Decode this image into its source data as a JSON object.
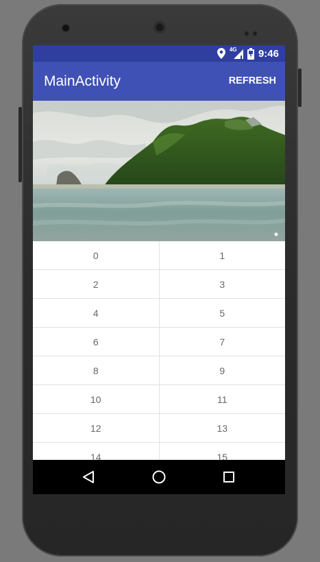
{
  "status_bar": {
    "time": "9:46",
    "network_label": "4G",
    "icons": [
      "location-icon",
      "signal-icon",
      "battery-icon"
    ]
  },
  "app_bar": {
    "title": "MainActivity",
    "action_label": "REFRESH"
  },
  "banner": {
    "image": "tropical-island-photo",
    "page_indicator_count": 1,
    "active_page": 1
  },
  "grid": {
    "rows": [
      [
        "0",
        "1"
      ],
      [
        "2",
        "3"
      ],
      [
        "4",
        "5"
      ],
      [
        "6",
        "7"
      ],
      [
        "8",
        "9"
      ],
      [
        "10",
        "11"
      ],
      [
        "12",
        "13"
      ],
      [
        "14",
        "15"
      ]
    ]
  },
  "nav_bar": {
    "icons": [
      "back-icon",
      "home-icon",
      "recents-icon"
    ]
  },
  "colors": {
    "status_bar": "#303f9f",
    "app_bar": "#3f51b5",
    "nav_bar": "#000000",
    "cell_text": "#666666"
  }
}
